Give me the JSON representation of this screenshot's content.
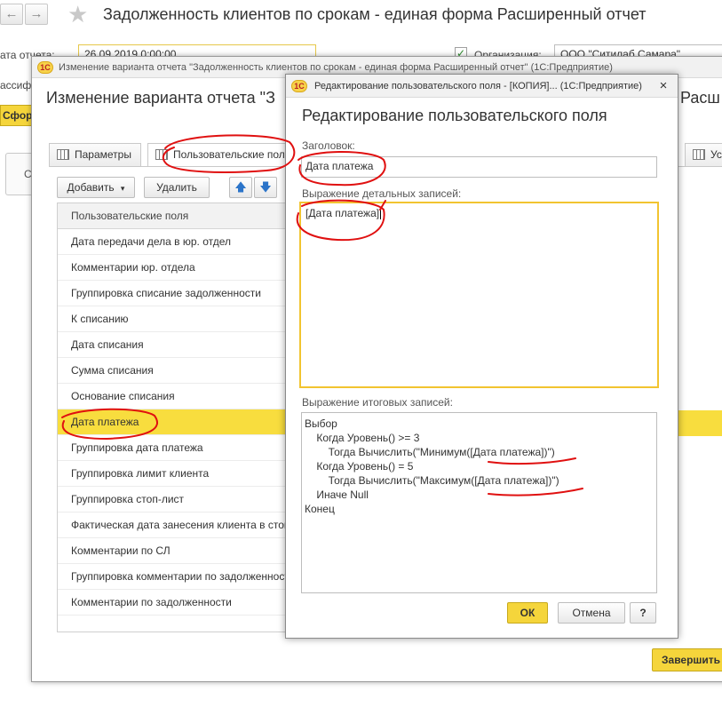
{
  "main": {
    "title": "Задолженность клиентов по срокам - единая форма Расширенный отчет",
    "date_label": "ата отчета:",
    "date_value": "26.09.2019  0:00:00",
    "classif_label": "ассиф",
    "org_label": "Организация:",
    "org_value": "ООО \"Ситилаб Самара\"",
    "form_button": "Сфор",
    "left_stub": "С",
    "nav_back": "←",
    "nav_forward": "→",
    "star": "★"
  },
  "variant_window": {
    "titlebar": "Изменение варианта отчета \"Задолженность клиентов по срокам - единая форма Расширенный отчет\"  (1С:Предприятие)",
    "heading": "Изменение варианта отчета \"З",
    "heading_right": "Расш",
    "tabs": {
      "params": "Параметры",
      "user_fields": "Пользовательские поля",
      "right": "Усл"
    },
    "toolbar": {
      "add": "Добавить",
      "add_arrow": "▾",
      "delete": "Удалить",
      "up": "🡅",
      "down": "🡇"
    },
    "list": {
      "header": "Пользовательские поля",
      "rows": [
        "Дата передачи дела в юр. отдел",
        "Комментарии юр. отдела",
        "Группировка списание задолженности",
        "К списанию",
        "Дата списания",
        "Сумма списания",
        "Основание списания",
        "Дата платежа",
        "Группировка дата платежа",
        "Группировка лимит клиента",
        "Группировка стоп-лист",
        "Фактическая дата занесения клиента в стоп-лист",
        "Комментарии по СЛ",
        "Группировка комментарии по задолженности",
        "Комментарии по задолженности"
      ],
      "selected_index": 7
    },
    "finish_button": "Завершить"
  },
  "edit_dialog": {
    "titlebar": "Редактирование пользовательского поля - [КОПИЯ]... (1С:Предприятие)",
    "close": "×",
    "logo": "1С",
    "heading": "Редактирование пользовательского поля",
    "title_label": "Заголовок:",
    "title_value": "Дата платежа",
    "detail_label": "Выражение детальных записей:",
    "detail_value": "[Дата платежа]",
    "total_label": "Выражение итоговых записей:",
    "total_lines": [
      "Выбор",
      "    Когда Уровень() >= 3",
      "        Тогда Вычислить(\"Минимум([Дата платежа])\")",
      "    Когда Уровень() = 5",
      "        Тогда Вычислить(\"Максимум([Дата платежа])\")",
      "    Иначе Null",
      "Конец"
    ],
    "ok": "ОК",
    "cancel": "Отмена",
    "help": "?"
  },
  "colors": {
    "accent_yellow": "#f5d53b",
    "selection_yellow": "#f8dd3e",
    "annotation_red": "#e01010"
  }
}
